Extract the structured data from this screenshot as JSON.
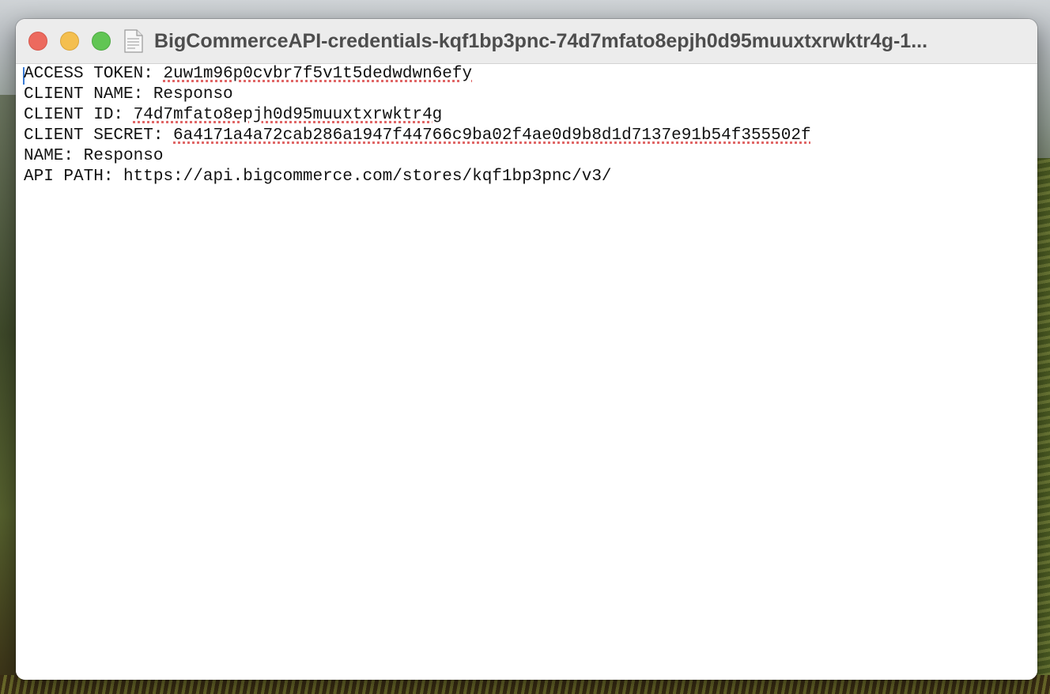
{
  "window": {
    "title": "BigCommerceAPI-credentials-kqf1bp3pnc-74d7mfato8epjh0d95muuxtxrwktr4g-1..."
  },
  "document": {
    "lines": [
      {
        "key": "ACCESS TOKEN: ",
        "value": "2uw1m96p0cvbr7f5v1t5dedwdwn6efy",
        "misspelled": true
      },
      {
        "key": "CLIENT NAME: ",
        "value": "Responso",
        "misspelled": false
      },
      {
        "key": "CLIENT ID: ",
        "value": "74d7mfato8epjh0d95muuxtxrwktr4g",
        "misspelled": true
      },
      {
        "key": "CLIENT SECRET: ",
        "value": "6a4171a4a72cab286a1947f44766c9ba02f4ae0d9b8d1d7137e91b54f355502f",
        "misspelled": true
      },
      {
        "key": "NAME: ",
        "value": "Responso",
        "misspelled": false
      },
      {
        "key": "API PATH: ",
        "value": "https://api.bigcommerce.com/stores/kqf1bp3pnc/v3/",
        "misspelled": false
      }
    ]
  },
  "colors": {
    "close": "#ec6a5e",
    "minimize": "#f4bf4f",
    "zoom": "#61c554",
    "spellcheck_underline": "#e06666",
    "caret": "#3a7bd5"
  },
  "icons": {
    "document": "document-icon",
    "close": "close-icon",
    "minimize": "minimize-icon",
    "zoom": "zoom-icon"
  }
}
